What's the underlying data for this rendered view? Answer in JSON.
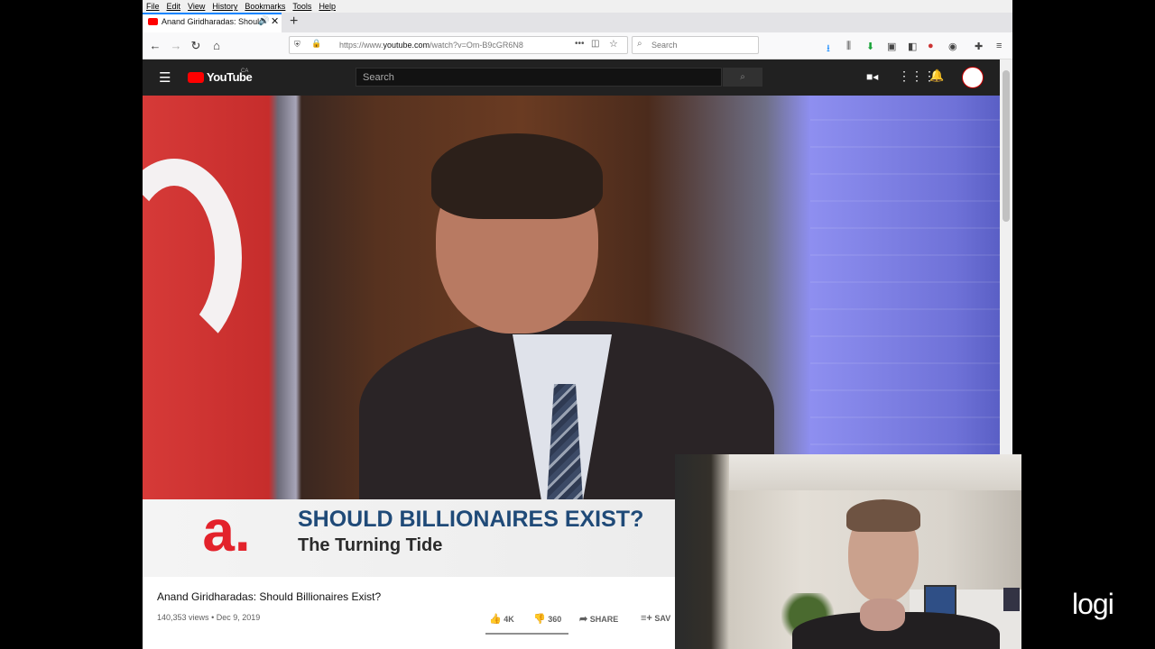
{
  "browser": {
    "menu": [
      "File",
      "Edit",
      "View",
      "History",
      "Bookmarks",
      "Tools",
      "Help"
    ],
    "tab_title": "Anand Giridharadas: Should",
    "new_tab_symbol": "+",
    "url_prefix": "https://www.",
    "url_domain": "youtube.com",
    "url_path": "/watch?v=Om-B9cGR6N8",
    "search_placeholder": "Search",
    "colors": {
      "tab_accent": "#0a84ff",
      "download_accent": "#0a84ff"
    }
  },
  "youtube": {
    "logo_text": "YouTube",
    "region": "CA",
    "search_placeholder": "Search",
    "video": {
      "lower_third_logo": "a.",
      "lower_third_title": "SHOULD BILLIONAIRES EXIST?",
      "lower_third_subtitle": "The Turning Tide"
    },
    "title": "Anand Giridharadas: Should Billionaires Exist?",
    "views": "140,353 views",
    "separator": "•",
    "date": "Dec 9, 2019",
    "likes": "4K",
    "dislikes": "360",
    "share_label": "SHARE",
    "save_label": "SAV",
    "colors": {
      "header": "#212121",
      "logo_red": "#ff0000"
    }
  },
  "webcam": {
    "brand": "logi"
  }
}
